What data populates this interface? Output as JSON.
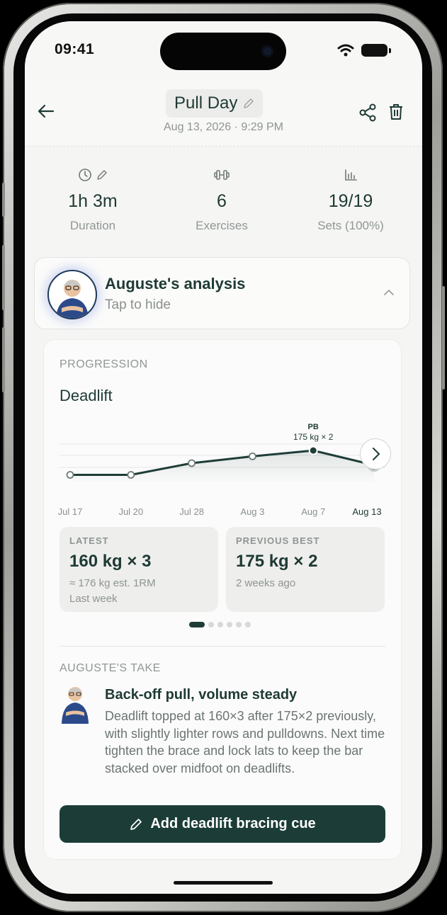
{
  "status_bar": {
    "time": "09:41"
  },
  "header": {
    "title": "Pull Day",
    "subtitle": "Aug 13, 2026 · 9:29 PM"
  },
  "stats": [
    {
      "value": "1h 3m",
      "label": "Duration",
      "icons": [
        "clock-icon",
        "pencil-icon"
      ]
    },
    {
      "value": "6",
      "label": "Exercises",
      "icons": [
        "dumbbell-icon"
      ]
    },
    {
      "value": "19/19",
      "label": "Sets (100%)",
      "icons": [
        "bar-chart-icon"
      ]
    }
  ],
  "analysis": {
    "title": "Auguste's analysis",
    "subtitle": "Tap to hide"
  },
  "progression": {
    "section_label": "PROGRESSION",
    "exercise": "Deadlift",
    "pb_label": "PB",
    "pb_value": "175 kg × 2"
  },
  "chart_data": {
    "type": "line",
    "x": [
      "Jul 17",
      "Jul 20",
      "Jul 28",
      "Aug 3",
      "Aug 7",
      "Aug 13"
    ],
    "series": [
      {
        "values": [
          150,
          150,
          162,
          169,
          175,
          160
        ]
      }
    ],
    "annotations": [
      {
        "x": "Aug 7",
        "text": "PB",
        "detail": "175 kg × 2"
      }
    ],
    "xlabel": "",
    "ylabel": "",
    "grid": true
  },
  "tiles": {
    "latest": {
      "label": "LATEST",
      "value": "160 kg × 3",
      "sub1": "≈ 176 kg est. 1RM",
      "sub2": "Last week"
    },
    "previous_best": {
      "label": "PREVIOUS BEST",
      "value": "175 kg × 2",
      "sub1": "2 weeks ago"
    }
  },
  "pager": {
    "count": 6,
    "active": 0
  },
  "take": {
    "section_label": "AUGUSTE'S TAKE",
    "title": "Back-off pull, volume steady",
    "body": "Deadlift topped at 160×3 after 175×2 previously, with slightly lighter rows and pulldowns. Next time tighten the brace and lock lats to keep the bar stacked over midfoot on deadlifts."
  },
  "cta": {
    "label": "Add deadlift bracing cue"
  },
  "colors": {
    "accent": "#1c3d37",
    "muted": "#8f9794"
  }
}
